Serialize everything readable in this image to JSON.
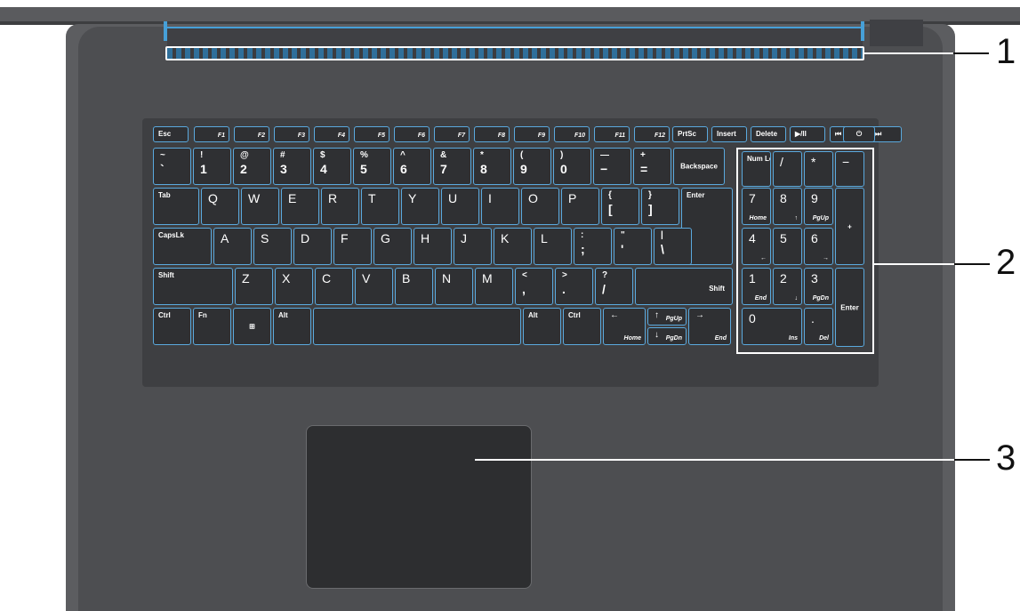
{
  "callouts": [
    "1",
    "2",
    "3"
  ],
  "function_row": [
    "Esc",
    "F1",
    "F2",
    "F3",
    "F4",
    "F5",
    "F6",
    "F7",
    "F8",
    "F9",
    "F10",
    "F11",
    "F12",
    "PrtSc",
    "Insert",
    "Delete",
    "▶/II",
    "⏮",
    "⏭",
    "⏻"
  ],
  "number_row": [
    {
      "top": "~",
      "bottom": "`"
    },
    {
      "top": "!",
      "bottom": "1"
    },
    {
      "top": "@",
      "bottom": "2"
    },
    {
      "top": "#",
      "bottom": "3"
    },
    {
      "top": "$",
      "bottom": "4"
    },
    {
      "top": "%",
      "bottom": "5"
    },
    {
      "top": "^",
      "bottom": "6"
    },
    {
      "top": "&",
      "bottom": "7"
    },
    {
      "top": "*",
      "bottom": "8"
    },
    {
      "top": "(",
      "bottom": "9"
    },
    {
      "top": ")",
      "bottom": "0"
    },
    {
      "top": "—",
      "bottom": "−"
    },
    {
      "top": "+",
      "bottom": "="
    }
  ],
  "backspace": "Backspace",
  "tab": "Tab",
  "qwerty_row": [
    "Q",
    "W",
    "E",
    "R",
    "T",
    "Y",
    "U",
    "I",
    "O",
    "P"
  ],
  "bracket_keys": [
    {
      "top": "{",
      "bottom": "["
    },
    {
      "top": "}",
      "bottom": "]"
    }
  ],
  "enter": "Enter",
  "capslock": "CapsLk",
  "home_row": [
    "A",
    "S",
    "D",
    "F",
    "G",
    "H",
    "J",
    "K",
    "L"
  ],
  "home_punct": [
    {
      "top": ":",
      "bottom": ";"
    },
    {
      "top": "\"",
      "bottom": "'"
    },
    {
      "top": "|",
      "bottom": "\\"
    }
  ],
  "shift": "Shift",
  "bottom_letters": [
    "Z",
    "X",
    "C",
    "V",
    "B",
    "N",
    "M"
  ],
  "bottom_punct": [
    {
      "top": "<",
      "bottom": ","
    },
    {
      "top": ">",
      "bottom": "."
    },
    {
      "top": "?",
      "bottom": "/"
    }
  ],
  "modifiers": {
    "ctrl": "Ctrl",
    "fn": "Fn",
    "win": "⊞",
    "alt": "Alt",
    "alt_r": "Alt",
    "ctrl_r": "Ctrl"
  },
  "arrows": {
    "left": "←",
    "left_sub": "Home",
    "up": "↑",
    "up_sub": "PgUp",
    "down": "↓",
    "down_sub": "PgDn",
    "right": "→",
    "right_sub": "End"
  },
  "numpad": {
    "numlock": "Num Lock",
    "slash": "/",
    "star": "*",
    "minus": "−",
    "plus": "+",
    "enter": "Enter",
    "k7": "7",
    "k7s": "Home",
    "k8": "8",
    "k8s": "↑",
    "k9": "9",
    "k9s": "PgUp",
    "k4": "4",
    "k4s": "←",
    "k5": "5",
    "k6": "6",
    "k6s": "→",
    "k1": "1",
    "k1s": "End",
    "k2": "2",
    "k2s": "↓",
    "k3": "3",
    "k3s": "PgDn",
    "k0": "0",
    "k0s": "Ins",
    "dot": ".",
    "dots": "Del"
  }
}
